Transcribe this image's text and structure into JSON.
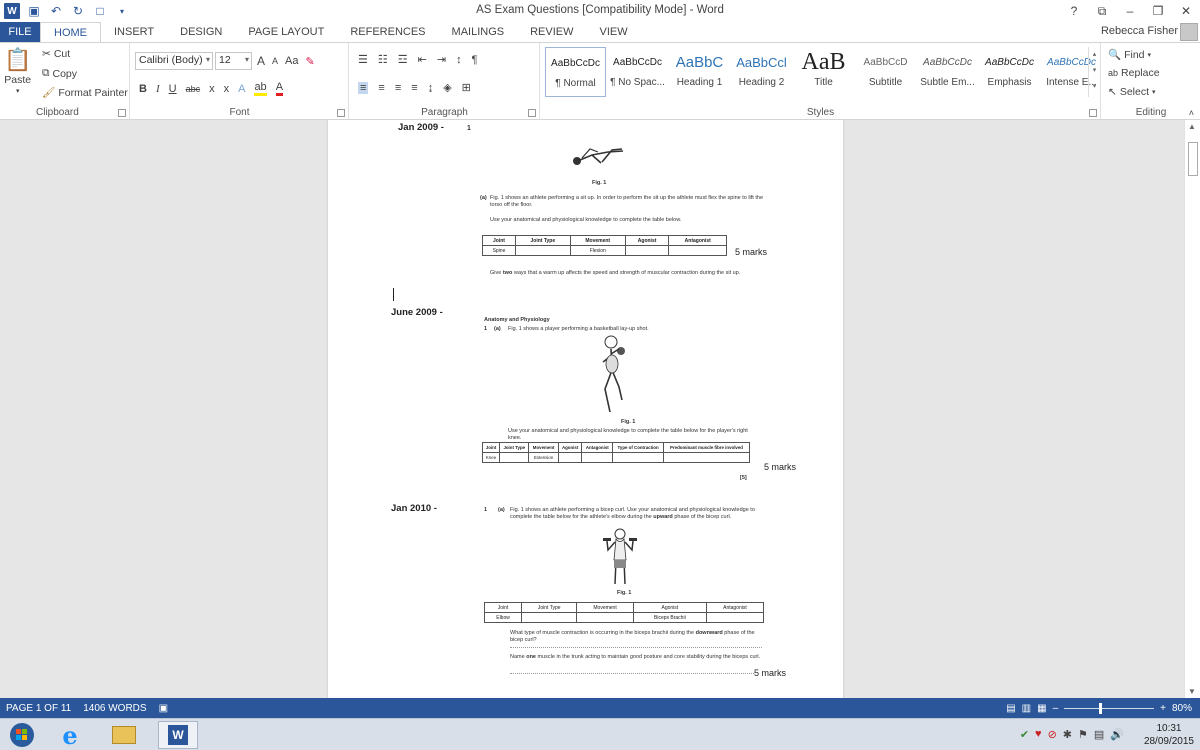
{
  "window": {
    "title": "AS Exam Questions [Compatibility Mode] - Word",
    "controls": [
      "?",
      "⧉",
      "–",
      "❐",
      "✕"
    ]
  },
  "quick_access": {
    "icons": [
      "save-icon",
      "undo-icon",
      "redo-icon",
      "new-document-icon",
      "customize-icon"
    ]
  },
  "tabs": {
    "file": "FILE",
    "items": [
      "HOME",
      "INSERT",
      "DESIGN",
      "PAGE LAYOUT",
      "REFERENCES",
      "MAILINGS",
      "REVIEW",
      "VIEW"
    ],
    "active": "HOME"
  },
  "account": {
    "user": "Rebecca Fisher"
  },
  "ribbon": {
    "clipboard": {
      "label": "Clipboard",
      "paste": "Paste",
      "cut": "Cut",
      "copy": "Copy",
      "format_painter": "Format Painter"
    },
    "font": {
      "label": "Font",
      "family": "Calibri (Body)",
      "size": "12",
      "grow": "A",
      "shrink": "A",
      "change_case": "Aa",
      "bold": "B",
      "italic": "I",
      "underline": "U",
      "strikethrough": "abc",
      "subscript": "x",
      "superscript": "x",
      "font_color": "A"
    },
    "paragraph": {
      "label": "Paragraph"
    },
    "styles": {
      "label": "Styles",
      "items": [
        {
          "preview": "AaBbCcDc",
          "name": "¶ Normal"
        },
        {
          "preview": "AaBbCcDc",
          "name": "¶ No Spac..."
        },
        {
          "preview": "AaBbC",
          "name": "Heading 1"
        },
        {
          "preview": "AaBbCcl",
          "name": "Heading 2"
        },
        {
          "preview": "AaB",
          "name": "Title"
        },
        {
          "preview": "AaBbCcD",
          "name": "Subtitle"
        },
        {
          "preview": "AaBbCcDc",
          "name": "Subtle Em..."
        },
        {
          "preview": "AaBbCcDc",
          "name": "Emphasis"
        },
        {
          "preview": "AaBbCcDc",
          "name": "Intense E..."
        }
      ]
    },
    "editing": {
      "label": "Editing",
      "find": "Find",
      "replace": "Replace",
      "select": "Select"
    }
  },
  "document": {
    "sections": [
      {
        "date": "Jan 2009 -",
        "question_number": "1"
      },
      {
        "date": "June 2009 -"
      },
      {
        "date": "Jan 2010 -"
      }
    ],
    "q1": {
      "fig_caption": "Fig. 1",
      "part_a_label": "(a)",
      "part_a_text": "Fig. 1 shows an athlete performing a sit up. In order to perform the sit up the athlete must flex the spine to lift the torso off the floor.",
      "instruction": "Use your anatomical and physiological knowledge to complete the table below.",
      "table_headers": [
        "Joint",
        "Joint Type",
        "Movement",
        "Agonist",
        "Antagonist"
      ],
      "table_row": [
        "Spine",
        "",
        "Flexion",
        "",
        ""
      ],
      "marks": "5 marks",
      "warmup_q_pre": "Give ",
      "warmup_q_bold": "two",
      "warmup_q_post": " ways that a warm up affects the speed and strength of muscular contraction during the sit up."
    },
    "q2": {
      "heading": "Anatomy and Physiology",
      "number": "1",
      "part": "(a)",
      "text": "Fig. 1 shows a player performing a basketball lay-up shot.",
      "fig_caption": "Fig. 1",
      "instruction": "Use your anatomical and physiological knowledge to complete the table below for the player's right knee.",
      "table_headers": [
        "Joint",
        "Joint Type",
        "Movement",
        "Agonist",
        "Antagonist",
        "Type of Contraction",
        "Predominant muscle fibre involved"
      ],
      "table_row": [
        "Knee",
        "",
        "Extension",
        "",
        "",
        "",
        ""
      ],
      "bracket": "[5]",
      "marks": "5 marks"
    },
    "q3": {
      "number": "1",
      "part": "(a)",
      "text_pre": "Fig. 1 shows an athlete performing a bicep curl. Use your anatomical and physiological knowledge to complete the table below for the athlete's elbow during the ",
      "text_bold": "upward",
      "text_post": " phase of the bicep curl.",
      "fig_caption": "Fig. 1",
      "table_headers": [
        "Joint",
        "Joint Type",
        "Movement",
        "Agonist",
        "Antagonist"
      ],
      "table_row": [
        "Elbow",
        "",
        "",
        "Biceps Brachii",
        ""
      ],
      "contraction_q_pre": "What type of muscle contraction is occurring in the biceps brachii during the ",
      "contraction_q_bold": "downward",
      "contraction_q_post": " phase of the bicep curl?",
      "trunk_q_pre": "Name ",
      "trunk_q_bold": "one",
      "trunk_q_post": " muscle in the trunk acting to maintain good posture and core stability during the biceps curl.",
      "marks": "5 marks"
    }
  },
  "status": {
    "page": "PAGE 1 OF 11",
    "words": "1406 WORDS",
    "zoom": "80%",
    "zoom_fraction": 0.8
  },
  "taskbar": {
    "time": "10:31",
    "date": "28/09/2015"
  }
}
